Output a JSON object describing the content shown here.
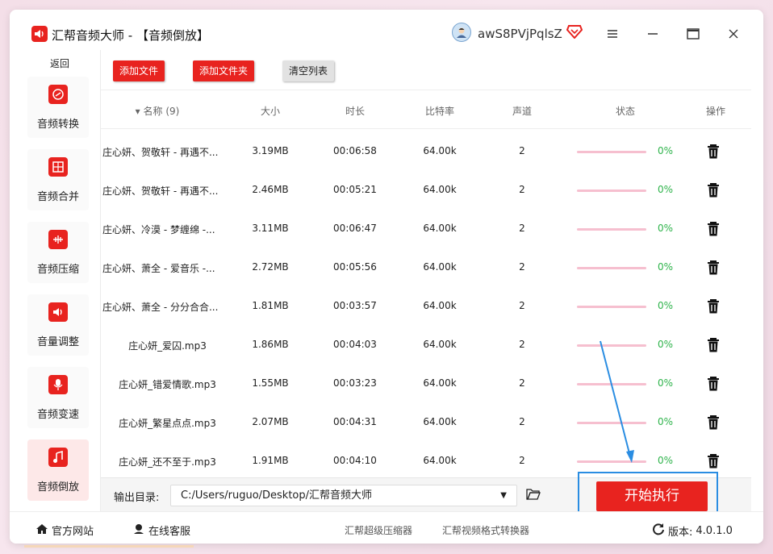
{
  "window": {
    "title": "汇帮音频大师  - 【音频倒放】",
    "user_name": "awS8PVjPqlsZ",
    "icons": {
      "app": "speaker-icon",
      "user": "avatar-icon",
      "vip": "diamond-icon",
      "menu": "hamburger-icon",
      "minimize": "minimize-icon",
      "maximize": "maximize-icon",
      "close": "close-icon"
    }
  },
  "sidebar": {
    "back_label": "返回",
    "items": [
      {
        "label": "音频转换",
        "icon": "convert-icon",
        "active": false
      },
      {
        "label": "音频合并",
        "icon": "merge-icon",
        "active": false
      },
      {
        "label": "音频压缩",
        "icon": "compress-icon",
        "active": false
      },
      {
        "label": "音量调整",
        "icon": "volume-icon",
        "active": false
      },
      {
        "label": "音频变速",
        "icon": "microphone-icon",
        "active": false
      },
      {
        "label": "音频倒放",
        "icon": "music-note-icon",
        "active": true
      }
    ]
  },
  "toolbar": {
    "add_file": "添加文件",
    "add_folder": "添加文件夹",
    "clear_list": "清空列表"
  },
  "table": {
    "headers": {
      "name": "▾ 名称 (9)",
      "size": "大小",
      "duration": "时长",
      "bitrate": "比特率",
      "channels": "声道",
      "status": "状态",
      "action": "操作"
    },
    "rows": [
      {
        "name": "庄心妍、贺敬轩 - 再遇不...",
        "size": "3.19MB",
        "duration": "00:06:58",
        "bitrate": "64.00k",
        "channels": "2",
        "progress": "0%"
      },
      {
        "name": "庄心妍、贺敬轩 - 再遇不...",
        "size": "2.46MB",
        "duration": "00:05:21",
        "bitrate": "64.00k",
        "channels": "2",
        "progress": "0%"
      },
      {
        "name": "庄心妍、冷漠 - 梦缠绵 -...",
        "size": "3.11MB",
        "duration": "00:06:47",
        "bitrate": "64.00k",
        "channels": "2",
        "progress": "0%"
      },
      {
        "name": "庄心妍、萧全 - 爱音乐 -...",
        "size": "2.72MB",
        "duration": "00:05:56",
        "bitrate": "64.00k",
        "channels": "2",
        "progress": "0%"
      },
      {
        "name": "庄心妍、萧全 - 分分合合...",
        "size": "1.81MB",
        "duration": "00:03:57",
        "bitrate": "64.00k",
        "channels": "2",
        "progress": "0%"
      },
      {
        "name": "庄心妍_爱囚.mp3",
        "size": "1.86MB",
        "duration": "00:04:03",
        "bitrate": "64.00k",
        "channels": "2",
        "progress": "0%"
      },
      {
        "name": "庄心妍_错爱情歌.mp3",
        "size": "1.55MB",
        "duration": "00:03:23",
        "bitrate": "64.00k",
        "channels": "2",
        "progress": "0%"
      },
      {
        "name": "庄心妍_繁星点点.mp3",
        "size": "2.07MB",
        "duration": "00:04:31",
        "bitrate": "64.00k",
        "channels": "2",
        "progress": "0%"
      },
      {
        "name": "庄心妍_还不至于.mp3",
        "size": "1.91MB",
        "duration": "00:04:10",
        "bitrate": "64.00k",
        "channels": "2",
        "progress": "0%"
      }
    ]
  },
  "output": {
    "label": "输出目录:",
    "path": "C:/Users/ruguo/Desktop/汇帮音频大师",
    "start_button": "开始执行"
  },
  "statusbar": {
    "website": "官方网站",
    "support": "在线客服",
    "link1": "汇帮超级压缩器",
    "link2": "汇帮视频格式转换器",
    "version_label": "版本:",
    "version": "4.0.1.0"
  },
  "colors": {
    "accent": "#e8231f",
    "progress_track": "#f6bfcf",
    "percent": "#2db34a",
    "highlight": "#2a8de2"
  }
}
